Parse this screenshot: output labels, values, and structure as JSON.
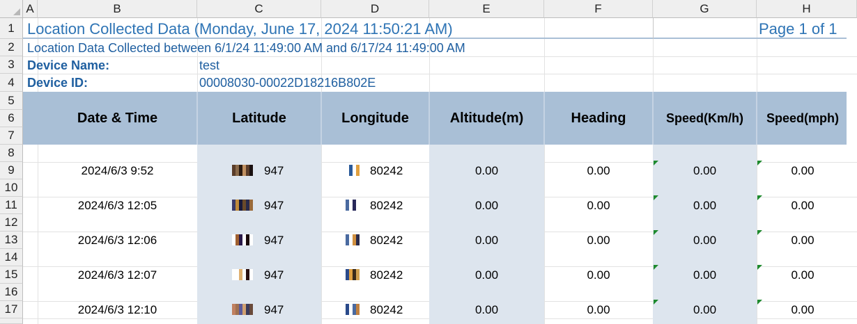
{
  "columns": [
    "A",
    "B",
    "C",
    "D",
    "E",
    "F",
    "G",
    "H"
  ],
  "rows": [
    "1",
    "2",
    "3",
    "4",
    "5",
    "6",
    "7",
    "8",
    "9",
    "10",
    "11",
    "12",
    "13",
    "14",
    "15",
    "16",
    "17"
  ],
  "report": {
    "title": "Location Collected Data  (Monday, June 17, 2024 11:50:21 AM)",
    "page": "Page 1 of 1",
    "range": "Location Data Collected between  6/1/24  11:49:00 AM and 6/17/24  11:49:00 AM",
    "device_name_label": "Device Name:",
    "device_name": "test",
    "device_id_label": "Device ID:",
    "device_id": "00008030-00022D18216B802E"
  },
  "table": {
    "headers": [
      "Date & Time",
      "Latitude",
      "Longitude",
      "Altitude(m)",
      "Heading",
      "Speed(Km/h)",
      "Speed(mph)"
    ],
    "rows": [
      {
        "datetime": "2024/6/3 9:52",
        "lat": "947",
        "lon": "80242",
        "alt": "0.00",
        "heading": "0.00",
        "kmh": "0.00",
        "mph": "0.00"
      },
      {
        "datetime": "2024/6/3 12:05",
        "lat": "947",
        "lon": "80242",
        "alt": "0.00",
        "heading": "0.00",
        "kmh": "0.00",
        "mph": "0.00"
      },
      {
        "datetime": "2024/6/3 12:06",
        "lat": "947",
        "lon": "80242",
        "alt": "0.00",
        "heading": "0.00",
        "kmh": "0.00",
        "mph": "0.00"
      },
      {
        "datetime": "2024/6/3 12:07",
        "lat": "947",
        "lon": "80242",
        "alt": "0.00",
        "heading": "0.00",
        "kmh": "0.00",
        "mph": "0.00"
      },
      {
        "datetime": "2024/6/3 12:10",
        "lat": "947",
        "lon": "80242",
        "alt": "0.00",
        "heading": "0.00",
        "kmh": "0.00",
        "mph": "0.00"
      }
    ]
  },
  "colors": {
    "title_blue": "#2e74b5",
    "header_band": "#a9bfd6",
    "shaded_column": "#dde5ee",
    "error_indicator": "#1e8a2e"
  }
}
